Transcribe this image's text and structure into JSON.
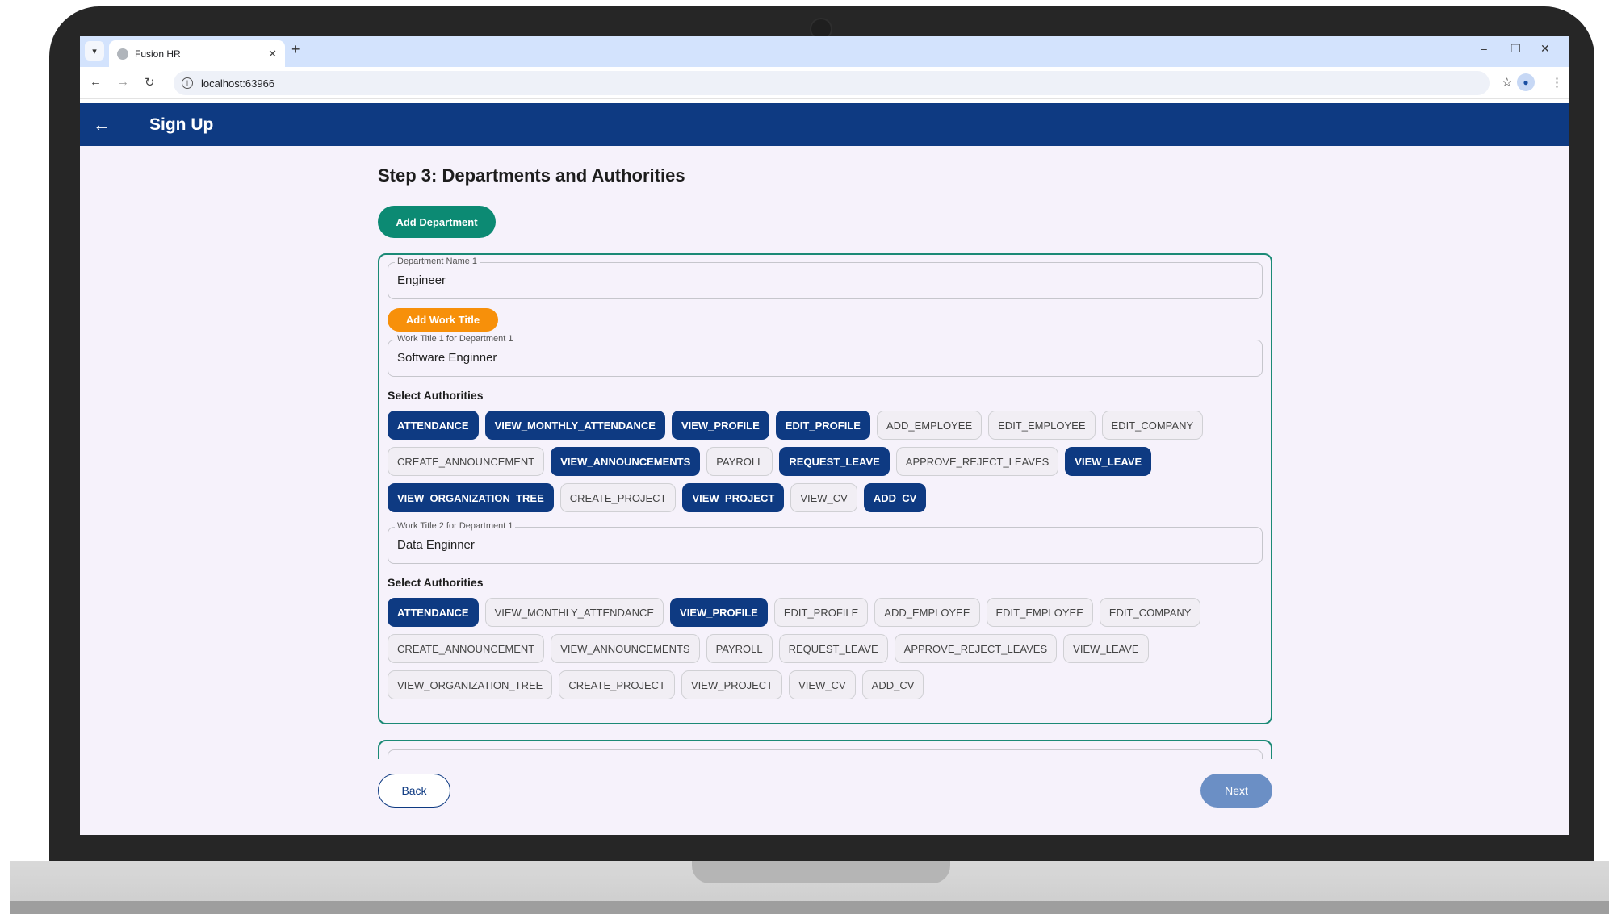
{
  "browser": {
    "tab_title": "Fusion HR",
    "tab_close": "✕",
    "new_tab": "+",
    "url": "localhost:63966",
    "window_controls": [
      "–",
      "❐",
      "✕"
    ]
  },
  "app_bar": {
    "back_icon": "←",
    "title": "Sign Up"
  },
  "page": {
    "step_title": "Step 3: Departments and Authorities",
    "add_department_label": "Add Department",
    "add_work_title_label": "Add Work Title",
    "back_label": "Back",
    "next_label": "Next"
  },
  "department": {
    "name_label": "Department Name 1",
    "name_value": "Engineer",
    "work_titles": [
      {
        "label": "Work Title 1 for Department 1",
        "value": "Software Enginner",
        "authorities_label": "Select Authorities",
        "authorities": [
          {
            "name": "ATTENDANCE",
            "selected": true
          },
          {
            "name": "VIEW_MONTHLY_ATTENDANCE",
            "selected": true
          },
          {
            "name": "VIEW_PROFILE",
            "selected": true
          },
          {
            "name": "EDIT_PROFILE",
            "selected": true
          },
          {
            "name": "ADD_EMPLOYEE",
            "selected": false
          },
          {
            "name": "EDIT_EMPLOYEE",
            "selected": false
          },
          {
            "name": "EDIT_COMPANY",
            "selected": false
          },
          {
            "name": "CREATE_ANNOUNCEMENT",
            "selected": false
          },
          {
            "name": "VIEW_ANNOUNCEMENTS",
            "selected": true
          },
          {
            "name": "PAYROLL",
            "selected": false
          },
          {
            "name": "REQUEST_LEAVE",
            "selected": true
          },
          {
            "name": "APPROVE_REJECT_LEAVES",
            "selected": false
          },
          {
            "name": "VIEW_LEAVE",
            "selected": true
          },
          {
            "name": "VIEW_ORGANIZATION_TREE",
            "selected": true
          },
          {
            "name": "CREATE_PROJECT",
            "selected": false
          },
          {
            "name": "VIEW_PROJECT",
            "selected": true
          },
          {
            "name": "VIEW_CV",
            "selected": false
          },
          {
            "name": "ADD_CV",
            "selected": true
          }
        ]
      },
      {
        "label": "Work Title 2 for Department 1",
        "value": "Data Enginner",
        "authorities_label": "Select Authorities",
        "authorities": [
          {
            "name": "ATTENDANCE",
            "selected": true
          },
          {
            "name": "VIEW_MONTHLY_ATTENDANCE",
            "selected": false
          },
          {
            "name": "VIEW_PROFILE",
            "selected": true
          },
          {
            "name": "EDIT_PROFILE",
            "selected": false
          },
          {
            "name": "ADD_EMPLOYEE",
            "selected": false
          },
          {
            "name": "EDIT_EMPLOYEE",
            "selected": false
          },
          {
            "name": "EDIT_COMPANY",
            "selected": false
          },
          {
            "name": "CREATE_ANNOUNCEMENT",
            "selected": false
          },
          {
            "name": "VIEW_ANNOUNCEMENTS",
            "selected": false
          },
          {
            "name": "PAYROLL",
            "selected": false
          },
          {
            "name": "REQUEST_LEAVE",
            "selected": false
          },
          {
            "name": "APPROVE_REJECT_LEAVES",
            "selected": false
          },
          {
            "name": "VIEW_LEAVE",
            "selected": false
          },
          {
            "name": "VIEW_ORGANIZATION_TREE",
            "selected": false
          },
          {
            "name": "CREATE_PROJECT",
            "selected": false
          },
          {
            "name": "VIEW_PROJECT",
            "selected": false
          },
          {
            "name": "VIEW_CV",
            "selected": false
          },
          {
            "name": "ADD_CV",
            "selected": false
          }
        ]
      }
    ]
  },
  "colors": {
    "app_bar": "#0e3a82",
    "selected_chip": "#0e3a82",
    "add_department": "#0c8a73",
    "add_work_title": "#f7900a",
    "card_border": "#1b8a76",
    "next_button": "#6b8fc5"
  }
}
